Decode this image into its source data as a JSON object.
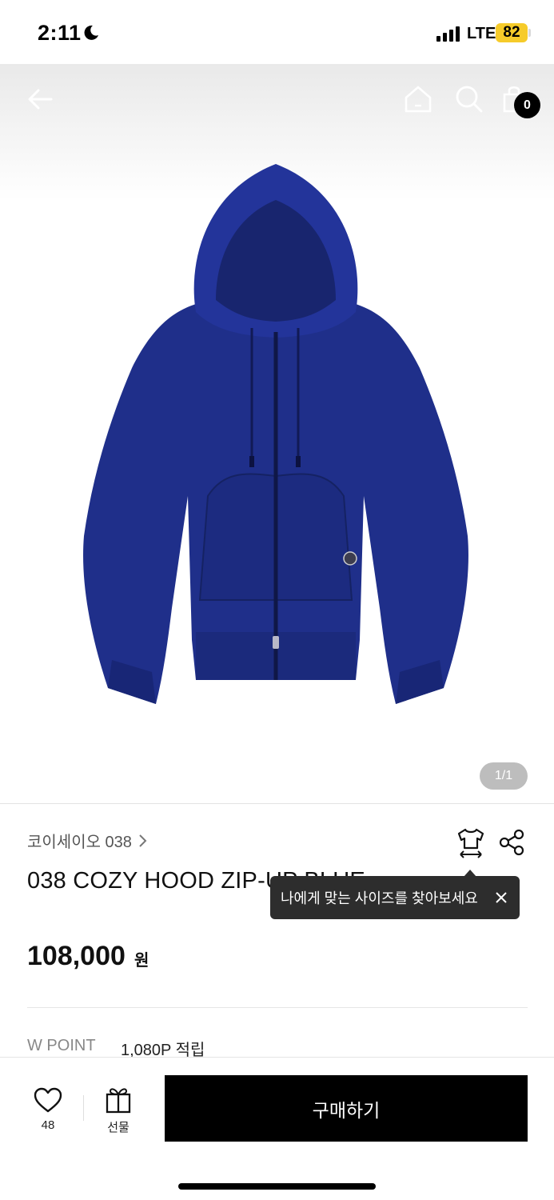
{
  "status_bar": {
    "time": "2:11",
    "network": "LTE",
    "battery": "82"
  },
  "header": {
    "cart_count": "0"
  },
  "gallery": {
    "counter": "1/1"
  },
  "product": {
    "brand": "코이세이오 038",
    "title": "038 COZY HOOD ZIP-UP BLUE",
    "price": "108,000",
    "price_unit": "원",
    "point_label": "W POINT",
    "point_value": "1,080P 적립"
  },
  "tooltip": {
    "text": "나에게 맞는 사이즈를 찾아보세요"
  },
  "bottom_bar": {
    "like_count": "48",
    "gift_label": "선물",
    "buy_label": "구매하기"
  },
  "colors": {
    "product": "#1f2f8a",
    "badge": "#f6cb2a",
    "buy_button": "#000000"
  },
  "icons": [
    "back-arrow-icon",
    "home-icon",
    "search-icon",
    "cart-icon",
    "hanger-size-icon",
    "share-icon",
    "heart-icon",
    "gift-icon",
    "close-icon",
    "chevron-right-icon",
    "moon-icon",
    "signal-icon"
  ]
}
